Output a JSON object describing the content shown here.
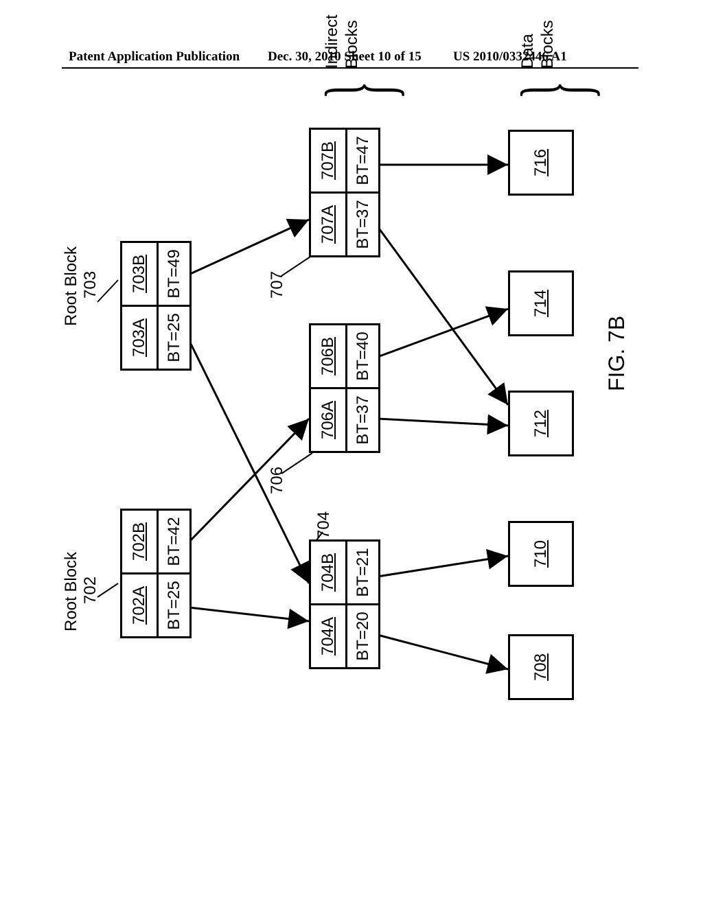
{
  "header": {
    "left": "Patent Application Publication",
    "mid": "Dec. 30, 2010  Sheet 10 of 15",
    "right": "US 2010/0332446 A1"
  },
  "figure_caption": "FIG. 7B",
  "labels": {
    "root_702_lbl": "Root Block",
    "root_702_num": "702",
    "root_703_lbl": "Root Block",
    "root_703_num": "703",
    "indirect_blocks": "Indirect\nBlocks",
    "data_blocks": "Data\nBlocks",
    "l704": "704",
    "l706": "706",
    "l707": "707"
  },
  "blocks": {
    "b702A": "702A",
    "bt702A": "BT=25",
    "b702B": "702B",
    "bt702B": "BT=42",
    "b703A": "703A",
    "bt703A": "BT=25",
    "b703B": "703B",
    "bt703B": "BT=49",
    "b704A": "704A",
    "bt704A": "BT=20",
    "b704B": "704B",
    "bt704B": "BT=21",
    "b706A": "706A",
    "bt706A": "BT=37",
    "b706B": "706B",
    "bt706B": "BT=40",
    "b707A": "707A",
    "bt707A": "BT=37",
    "b707B": "707B",
    "bt707B": "BT=47",
    "d708": "708",
    "d710": "710",
    "d712": "712",
    "d714": "714",
    "d716": "716"
  },
  "chart_data": {
    "type": "tree-diagram",
    "root_blocks": [
      {
        "id": "702",
        "cells": [
          {
            "id": "702A",
            "bt": 25
          },
          {
            "id": "702B",
            "bt": 42
          }
        ]
      },
      {
        "id": "703",
        "cells": [
          {
            "id": "703A",
            "bt": 25
          },
          {
            "id": "703B",
            "bt": 49
          }
        ]
      }
    ],
    "indirect_blocks": [
      {
        "id": "704",
        "cells": [
          {
            "id": "704A",
            "bt": 20
          },
          {
            "id": "704B",
            "bt": 21
          }
        ]
      },
      {
        "id": "706",
        "cells": [
          {
            "id": "706A",
            "bt": 37
          },
          {
            "id": "706B",
            "bt": 40
          }
        ]
      },
      {
        "id": "707",
        "cells": [
          {
            "id": "707A",
            "bt": 37
          },
          {
            "id": "707B",
            "bt": 47
          }
        ]
      }
    ],
    "data_blocks": [
      708,
      710,
      712,
      714,
      716
    ],
    "edges": [
      {
        "from": "702A",
        "to": "704"
      },
      {
        "from": "702B",
        "to": "706"
      },
      {
        "from": "703A",
        "to": "704"
      },
      {
        "from": "703B",
        "to": "707"
      },
      {
        "from": "704A",
        "to": "708"
      },
      {
        "from": "704B",
        "to": "710"
      },
      {
        "from": "706A",
        "to": "712"
      },
      {
        "from": "706B",
        "to": "714"
      },
      {
        "from": "707A",
        "to": "712"
      },
      {
        "from": "707B",
        "to": "716"
      }
    ]
  }
}
